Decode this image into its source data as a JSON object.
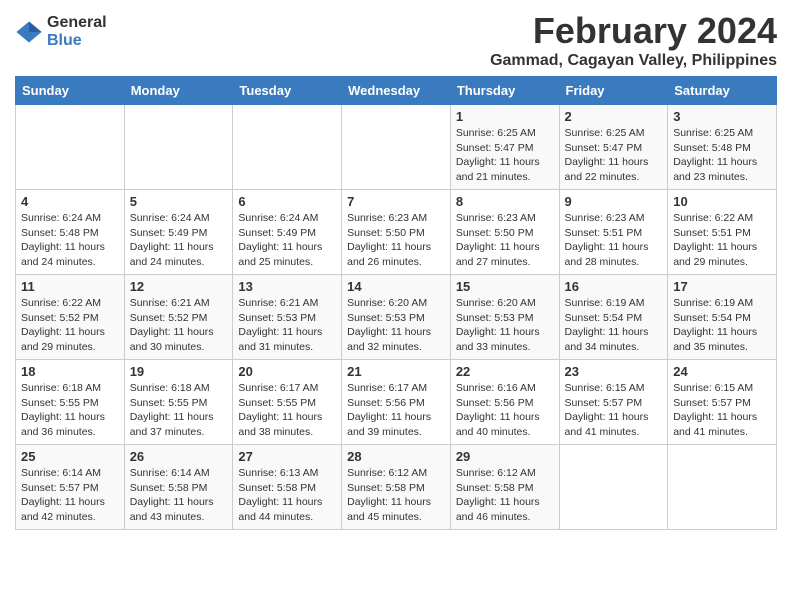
{
  "header": {
    "logo_general": "General",
    "logo_blue": "Blue",
    "month_year": "February 2024",
    "location": "Gammad, Cagayan Valley, Philippines"
  },
  "weekdays": [
    "Sunday",
    "Monday",
    "Tuesday",
    "Wednesday",
    "Thursday",
    "Friday",
    "Saturday"
  ],
  "weeks": [
    [
      {
        "day": "",
        "info": ""
      },
      {
        "day": "",
        "info": ""
      },
      {
        "day": "",
        "info": ""
      },
      {
        "day": "",
        "info": ""
      },
      {
        "day": "1",
        "info": "Sunrise: 6:25 AM\nSunset: 5:47 PM\nDaylight: 11 hours\nand 21 minutes."
      },
      {
        "day": "2",
        "info": "Sunrise: 6:25 AM\nSunset: 5:47 PM\nDaylight: 11 hours\nand 22 minutes."
      },
      {
        "day": "3",
        "info": "Sunrise: 6:25 AM\nSunset: 5:48 PM\nDaylight: 11 hours\nand 23 minutes."
      }
    ],
    [
      {
        "day": "4",
        "info": "Sunrise: 6:24 AM\nSunset: 5:48 PM\nDaylight: 11 hours\nand 24 minutes."
      },
      {
        "day": "5",
        "info": "Sunrise: 6:24 AM\nSunset: 5:49 PM\nDaylight: 11 hours\nand 24 minutes."
      },
      {
        "day": "6",
        "info": "Sunrise: 6:24 AM\nSunset: 5:49 PM\nDaylight: 11 hours\nand 25 minutes."
      },
      {
        "day": "7",
        "info": "Sunrise: 6:23 AM\nSunset: 5:50 PM\nDaylight: 11 hours\nand 26 minutes."
      },
      {
        "day": "8",
        "info": "Sunrise: 6:23 AM\nSunset: 5:50 PM\nDaylight: 11 hours\nand 27 minutes."
      },
      {
        "day": "9",
        "info": "Sunrise: 6:23 AM\nSunset: 5:51 PM\nDaylight: 11 hours\nand 28 minutes."
      },
      {
        "day": "10",
        "info": "Sunrise: 6:22 AM\nSunset: 5:51 PM\nDaylight: 11 hours\nand 29 minutes."
      }
    ],
    [
      {
        "day": "11",
        "info": "Sunrise: 6:22 AM\nSunset: 5:52 PM\nDaylight: 11 hours\nand 29 minutes."
      },
      {
        "day": "12",
        "info": "Sunrise: 6:21 AM\nSunset: 5:52 PM\nDaylight: 11 hours\nand 30 minutes."
      },
      {
        "day": "13",
        "info": "Sunrise: 6:21 AM\nSunset: 5:53 PM\nDaylight: 11 hours\nand 31 minutes."
      },
      {
        "day": "14",
        "info": "Sunrise: 6:20 AM\nSunset: 5:53 PM\nDaylight: 11 hours\nand 32 minutes."
      },
      {
        "day": "15",
        "info": "Sunrise: 6:20 AM\nSunset: 5:53 PM\nDaylight: 11 hours\nand 33 minutes."
      },
      {
        "day": "16",
        "info": "Sunrise: 6:19 AM\nSunset: 5:54 PM\nDaylight: 11 hours\nand 34 minutes."
      },
      {
        "day": "17",
        "info": "Sunrise: 6:19 AM\nSunset: 5:54 PM\nDaylight: 11 hours\nand 35 minutes."
      }
    ],
    [
      {
        "day": "18",
        "info": "Sunrise: 6:18 AM\nSunset: 5:55 PM\nDaylight: 11 hours\nand 36 minutes."
      },
      {
        "day": "19",
        "info": "Sunrise: 6:18 AM\nSunset: 5:55 PM\nDaylight: 11 hours\nand 37 minutes."
      },
      {
        "day": "20",
        "info": "Sunrise: 6:17 AM\nSunset: 5:55 PM\nDaylight: 11 hours\nand 38 minutes."
      },
      {
        "day": "21",
        "info": "Sunrise: 6:17 AM\nSunset: 5:56 PM\nDaylight: 11 hours\nand 39 minutes."
      },
      {
        "day": "22",
        "info": "Sunrise: 6:16 AM\nSunset: 5:56 PM\nDaylight: 11 hours\nand 40 minutes."
      },
      {
        "day": "23",
        "info": "Sunrise: 6:15 AM\nSunset: 5:57 PM\nDaylight: 11 hours\nand 41 minutes."
      },
      {
        "day": "24",
        "info": "Sunrise: 6:15 AM\nSunset: 5:57 PM\nDaylight: 11 hours\nand 41 minutes."
      }
    ],
    [
      {
        "day": "25",
        "info": "Sunrise: 6:14 AM\nSunset: 5:57 PM\nDaylight: 11 hours\nand 42 minutes."
      },
      {
        "day": "26",
        "info": "Sunrise: 6:14 AM\nSunset: 5:58 PM\nDaylight: 11 hours\nand 43 minutes."
      },
      {
        "day": "27",
        "info": "Sunrise: 6:13 AM\nSunset: 5:58 PM\nDaylight: 11 hours\nand 44 minutes."
      },
      {
        "day": "28",
        "info": "Sunrise: 6:12 AM\nSunset: 5:58 PM\nDaylight: 11 hours\nand 45 minutes."
      },
      {
        "day": "29",
        "info": "Sunrise: 6:12 AM\nSunset: 5:58 PM\nDaylight: 11 hours\nand 46 minutes."
      },
      {
        "day": "",
        "info": ""
      },
      {
        "day": "",
        "info": ""
      }
    ]
  ]
}
